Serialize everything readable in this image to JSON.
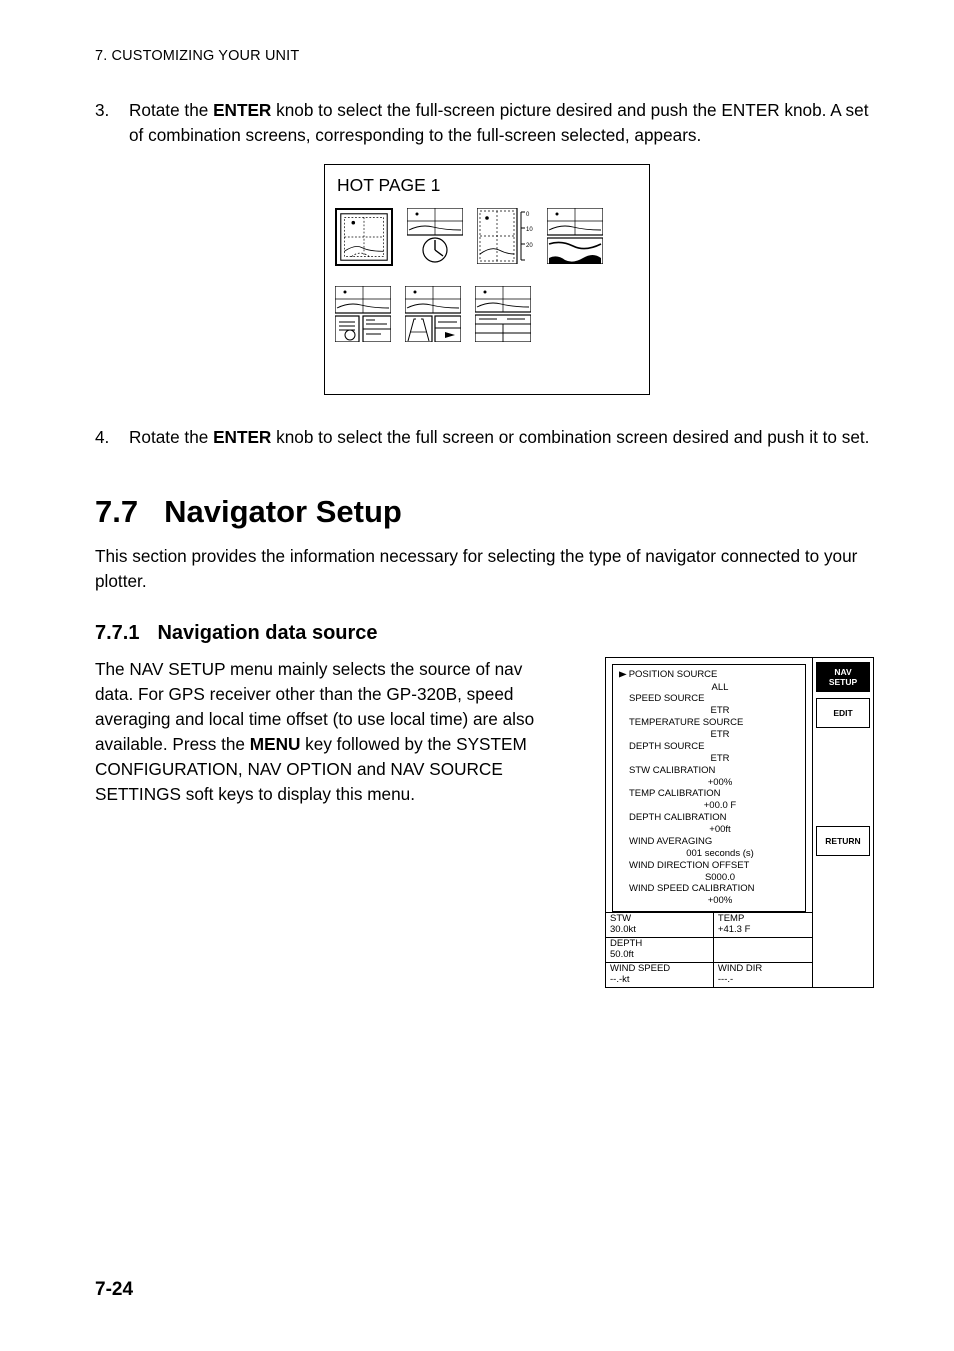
{
  "runningHeader": "7. CUSTOMIZING YOUR UNIT",
  "list3": {
    "num": "3.",
    "text_a": "Rotate the ",
    "bold_a": "ENTER",
    "text_b": " knob to select the full-screen picture desired and push the ENTER knob. A set of combination screens, corresponding to the full-screen selected, appears."
  },
  "hotPage": {
    "title": "HOT PAGE 1",
    "scale10": "10",
    "scale20": "20"
  },
  "list4": {
    "num": "4.",
    "text_a": "Rotate the ",
    "bold_a": "ENTER",
    "text_b": " knob to select the full screen or combination screen desired and push it to set."
  },
  "sec77": {
    "num": "7.7",
    "title": "Navigator Setup",
    "para": "This section provides the information necessary for selecting the type of navigator connected to your plotter."
  },
  "sec771": {
    "num": "7.7.1",
    "title": "Navigation data source",
    "para_a": "The NAV SETUP menu mainly selects the source of nav data. For GPS receiver other than the GP-320B, speed averaging and local time offset (to use local time) are also available. Press the ",
    "bold_a": "MENU",
    "para_b": " key followed by the SYSTEM CONFIGURATION, NAV OPTION and NAV SOURCE SETTINGS soft keys to display this menu."
  },
  "navMenu": {
    "items": [
      {
        "label": "POSITION SOURCE",
        "value": "ALL"
      },
      {
        "label": "SPEED SOURCE",
        "value": "ETR"
      },
      {
        "label": "TEMPERATURE SOURCE",
        "value": "ETR"
      },
      {
        "label": "DEPTH SOURCE",
        "value": "ETR"
      },
      {
        "label": "STW CALIBRATION",
        "value": "+00%"
      },
      {
        "label": "TEMP CALIBRATION",
        "value": "+00.0 F"
      },
      {
        "label": "DEPTH CALIBRATION",
        "value": "+00ft"
      },
      {
        "label": "WIND AVERAGING",
        "value": "001 seconds (s)"
      },
      {
        "label": "WIND DIRECTION OFFSET",
        "value": "S000.0"
      },
      {
        "label": "WIND SPEED CALIBRATION",
        "value": "+00%"
      }
    ],
    "dataCells": {
      "stw_l": "STW",
      "stw_v": "30.0kt",
      "temp_l": "TEMP",
      "temp_v": "+41.3 F",
      "depth_l": "DEPTH",
      "depth_v": "50.0ft",
      "depth_blank": "",
      "ws_l": "WIND SPEED",
      "ws_v": "--.-kt",
      "wd_l": "WIND DIR",
      "wd_v": "---.-"
    },
    "softkeys": {
      "navsetup": "NAV SETUP",
      "edit": "EDIT",
      "ret": "RETURN"
    }
  },
  "pageNumber": "7-24"
}
